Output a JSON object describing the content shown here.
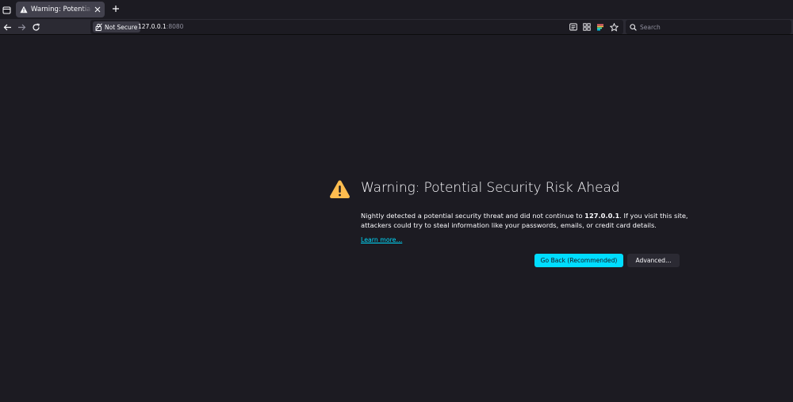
{
  "tabs": [
    {
      "title": "Warning: Potential Security Risk Ahead",
      "icon": "warning-icon",
      "active": true
    }
  ],
  "toolbar": {
    "back_icon": "arrow-left-icon",
    "forward_icon": "arrow-right-icon",
    "reload_icon": "reload-icon"
  },
  "urlbar": {
    "security_label": "Not Secure",
    "host": "127.0.0.1",
    "port": ":8080"
  },
  "search": {
    "placeholder": "Search"
  },
  "error_page": {
    "title": "Warning: Potential Security Risk Ahead",
    "description_before": "Nightly detected a potential security threat and did not continue to ",
    "description_host": "127.0.0.1",
    "description_after": ". If you visit this site, attackers could try to steal information like your passwords, emails, or credit card details.",
    "learn_more": "Learn more…",
    "go_back_label": "Go Back (Recommended)",
    "advanced_label": "Advanced…"
  },
  "colors": {
    "background": "#1c1b22",
    "toolbar": "#2b2a33",
    "accent": "#00ddff",
    "warning": "#ffbd4f"
  }
}
